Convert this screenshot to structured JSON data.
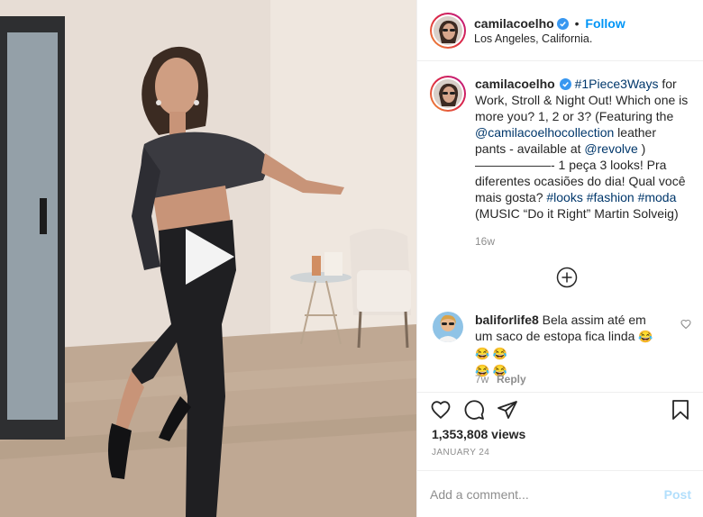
{
  "header": {
    "username": "camilacoelho",
    "separator": "•",
    "follow_label": "Follow",
    "location": "Los Angeles, California."
  },
  "caption": {
    "username": "camilacoelho",
    "hashtag_1": "#1Piece3Ways",
    "text_1": " for Work, Stroll & Night Out! Which one is more you? 1, 2 or 3? (Featuring the ",
    "mention_1": "@camilacoelhocollection",
    "text_2": " leather pants - available at ",
    "mention_2": "@revolve",
    "text_3": " ) ——————- 1 peça 3 looks! Pra diferentes ocasiões do dia! Qual você mais gosta? ",
    "hashtag_2": "#looks",
    "hashtag_3": "#fashion",
    "hashtag_4": "#moda",
    "text_4": " (MUSIC “Do it Right” Martin Solveig)",
    "time": "16w"
  },
  "comment": {
    "username": "baliforlife8",
    "text": " Bela assim até em um saco de estopa fica linda ",
    "emoji_line_1": "😂 😂 😂",
    "emoji_line_2": "😂 😂",
    "time": "7w",
    "reply_label": "Reply"
  },
  "stats": {
    "views": "1,353,808 views",
    "date": "January 24"
  },
  "add_comment": {
    "placeholder": "Add a comment...",
    "post_label": "Post"
  },
  "icons": {
    "like": "heart-icon",
    "comment": "comment-icon",
    "share": "paper-plane-icon",
    "save": "bookmark-icon",
    "more": "plus-circle-icon",
    "play": "play-icon",
    "verified": "verified-badge-icon"
  },
  "colors": {
    "link_blue": "#0095f6",
    "hashtag": "#00376b",
    "muted": "#8e8e8e",
    "post_disabled": "#b2dffc"
  }
}
